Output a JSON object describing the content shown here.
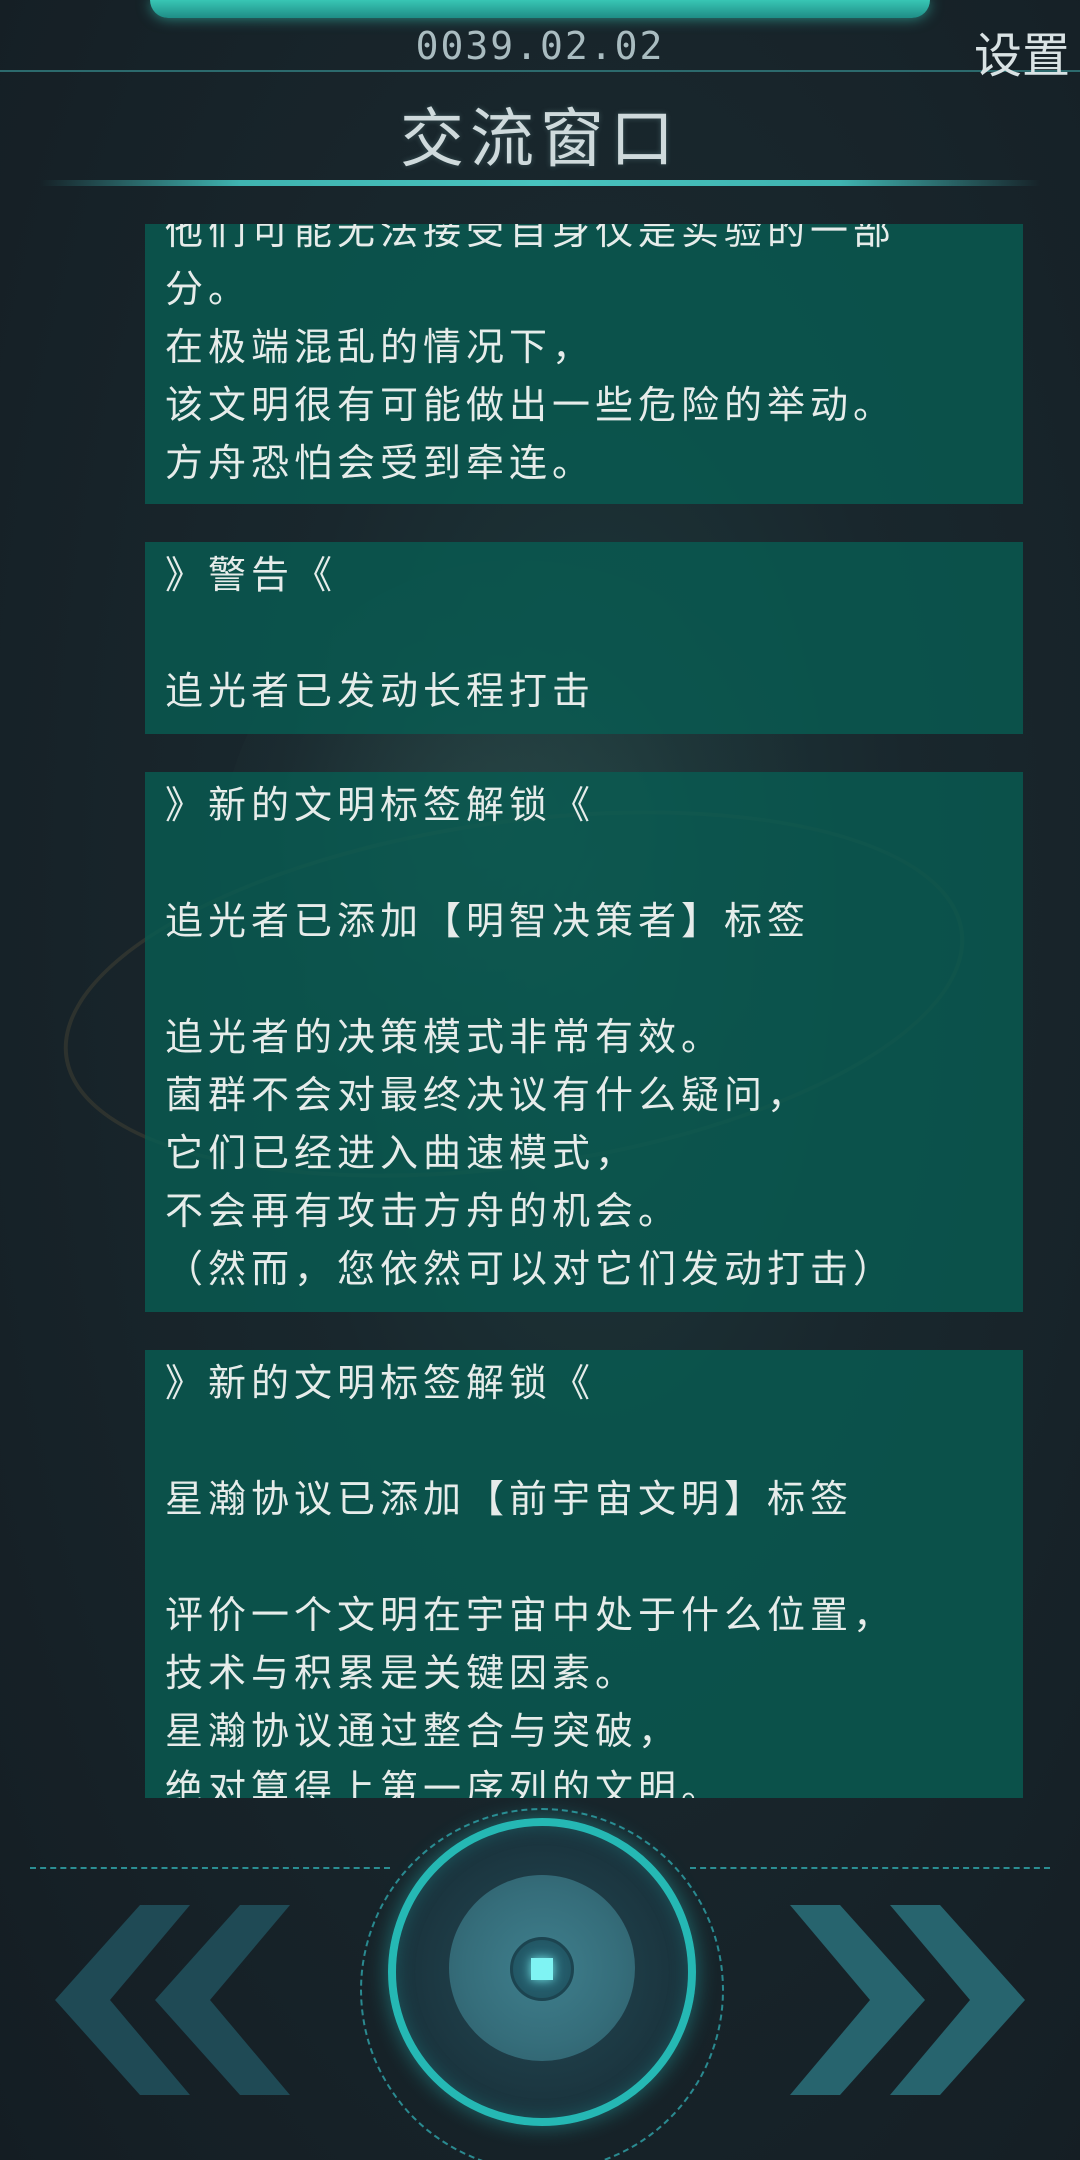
{
  "header": {
    "date": "0039.02.02",
    "settings_label": "设置",
    "title": "交流窗口"
  },
  "messages": [
    {
      "lines": [
        "他们可能无法接受自身仅是实验的一部",
        "分。",
        "在极端混乱的情况下，",
        "该文明很有可能做出一些危险的举动。",
        "方舟恐怕会受到牵连。"
      ]
    },
    {
      "heading": "》警告《",
      "lines": [
        "追光者已发动长程打击"
      ]
    },
    {
      "heading": "》新的文明标签解锁《",
      "tag_line": "追光者已添加【明智决策者】标签",
      "lines": [
        "追光者的决策模式非常有效。",
        "菌群不会对最终决议有什么疑问，",
        "它们已经进入曲速模式，",
        "不会再有攻击方舟的机会。",
        "（然而，您依然可以对它们发动打击）"
      ]
    },
    {
      "heading": "》新的文明标签解锁《",
      "tag_line": "星瀚协议已添加【前宇宙文明】标签",
      "lines": [
        "评价一个文明在宇宙中处于什么位置，",
        "技术与积累是关键因素。",
        "星瀚协议通过整合与突破，",
        "绝对算得上第一序列的文明。"
      ]
    }
  ],
  "controls": {
    "prev_icon": "double-chevron-left-icon",
    "center_icon": "center-core-button",
    "next_icon": "double-chevron-right-icon"
  },
  "colors": {
    "message_bg": "#085c52",
    "accent": "#25b8b4",
    "chevron": "#1f4f5a"
  }
}
